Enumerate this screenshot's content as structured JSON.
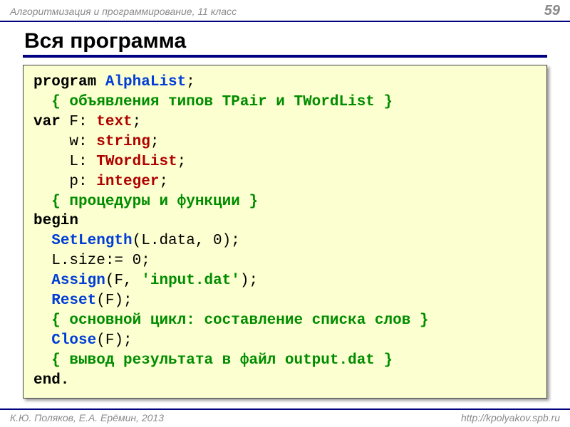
{
  "header": {
    "course": "Алгоритмизация и программирование, 11 класс",
    "page": "59"
  },
  "title": "Вся программа",
  "code": {
    "kw_program": "program",
    "prog_name": "AlphaList",
    "semicolon": ";",
    "cmt_types": "{ объявления типов TPair и TWordList }",
    "kw_var": "var",
    "v_F": "F:",
    "t_text": "text",
    "v_w": "w:",
    "t_string": "string",
    "v_L": "L:",
    "t_wordlist": "TWordList",
    "v_p": "p:",
    "t_integer": "integer",
    "cmt_procs": "{ процедуры и функции }",
    "kw_begin": "begin",
    "fn_setlength": "SetLength",
    "setlength_args": "(L.data, 0);",
    "line_lsize": "L.size:= 0;",
    "fn_assign": "Assign",
    "assign_open": "(F, ",
    "assign_str": "'input.dat'",
    "assign_close": ");",
    "fn_reset": "Reset",
    "reset_args": "(F);",
    "cmt_main": "{ основной цикл: составление списка слов }",
    "fn_close": "Close",
    "close_args": "(F);",
    "cmt_output": "{ вывод результата в файл output.dat }",
    "kw_end": "end."
  },
  "footer": {
    "left": "К.Ю. Поляков, Е.А. Ерёмин, 2013",
    "right": "http://kpolyakov.spb.ru"
  }
}
